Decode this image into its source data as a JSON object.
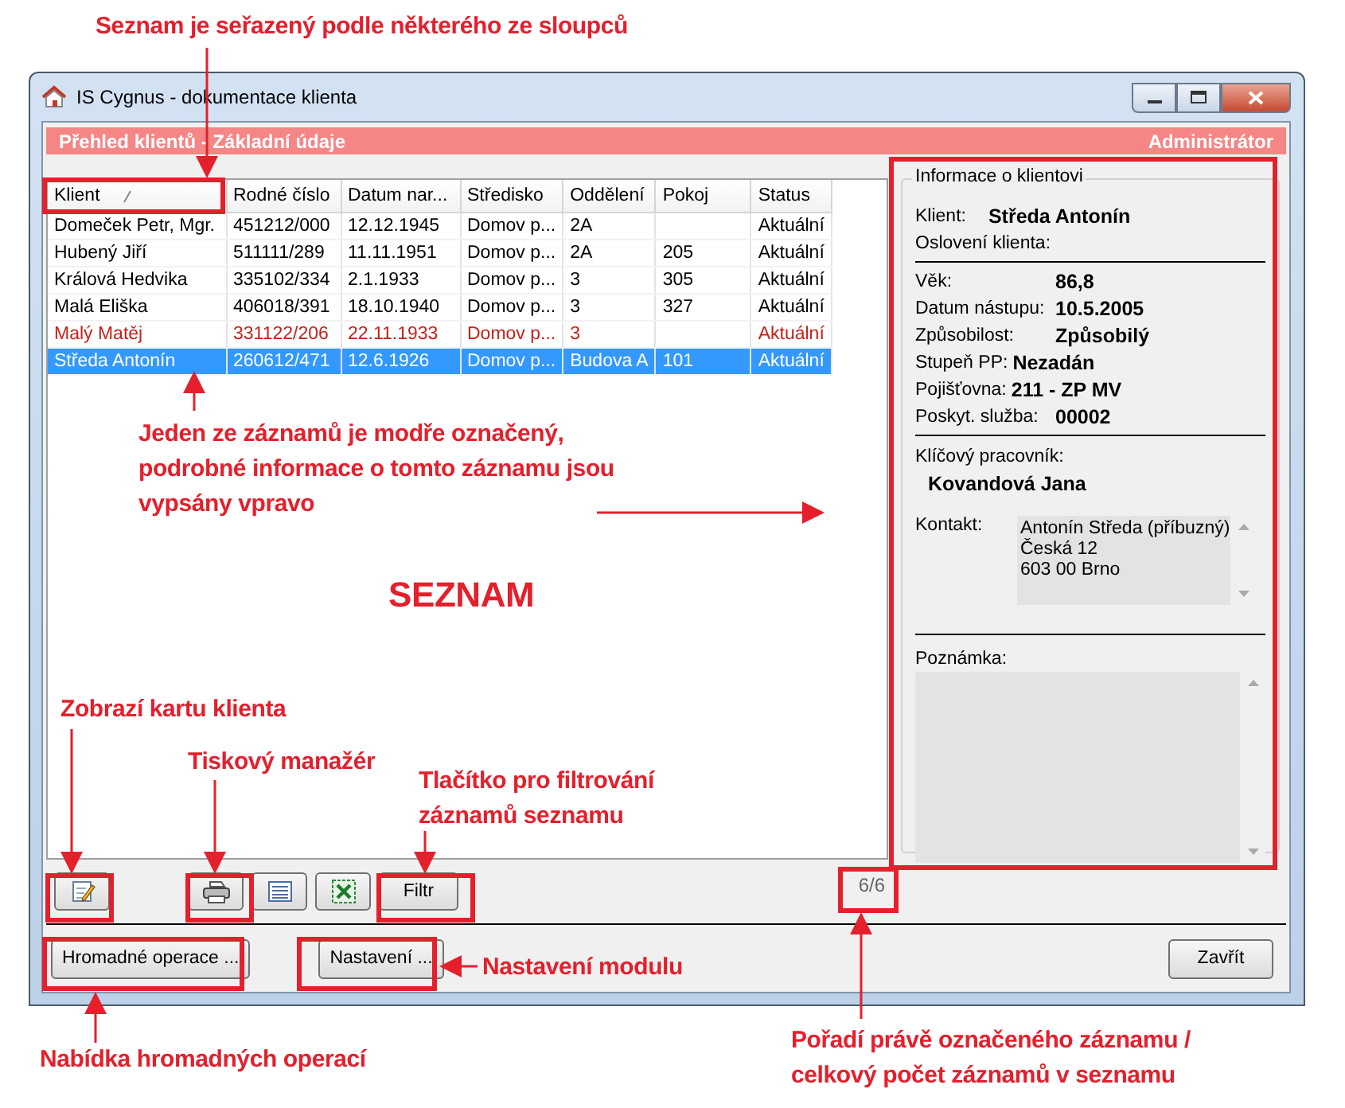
{
  "window": {
    "title": "IS Cygnus - dokumentace klienta"
  },
  "header": {
    "title": "Přehled klientů - Základní údaje",
    "user": "Administrátor"
  },
  "table": {
    "columns": [
      {
        "label": "Klient",
        "sorted": true
      },
      {
        "label": "Rodné číslo",
        "sorted": false
      },
      {
        "label": "Datum nar...",
        "sorted": false
      },
      {
        "label": "Středisko",
        "sorted": false
      },
      {
        "label": "Oddělení",
        "sorted": false
      },
      {
        "label": "Pokoj",
        "sorted": false
      },
      {
        "label": "Status",
        "sorted": false
      }
    ],
    "rows": [
      {
        "cells": [
          "Domeček Petr, Mgr.",
          "451212/000",
          "12.12.1945",
          "Domov p...",
          "2A",
          "",
          "Aktuální"
        ],
        "selected": false,
        "flagged": false
      },
      {
        "cells": [
          "Hubený Jiří",
          "511111/289",
          "11.11.1951",
          "Domov p...",
          "2A",
          "205",
          "Aktuální"
        ],
        "selected": false,
        "flagged": false
      },
      {
        "cells": [
          "Králová Hedvika",
          "335102/334",
          "2.1.1933",
          "Domov p...",
          "3",
          "305",
          "Aktuální"
        ],
        "selected": false,
        "flagged": false
      },
      {
        "cells": [
          "Malá Eliška",
          "406018/391",
          "18.10.1940",
          "Domov p...",
          "3",
          "327",
          "Aktuální"
        ],
        "selected": false,
        "flagged": false
      },
      {
        "cells": [
          "Malý Matěj",
          "331122/206",
          "22.11.1933",
          "Domov p...",
          "3",
          "",
          "Aktuální"
        ],
        "selected": false,
        "flagged": true
      },
      {
        "cells": [
          "Středa Antonín",
          "260612/471",
          "12.6.1926",
          "Domov p...",
          "Budova A",
          "101",
          "Aktuální"
        ],
        "selected": true,
        "flagged": false
      }
    ]
  },
  "info_panel": {
    "title": "Informace o klientovi",
    "client": {
      "label": "Klient:",
      "value": "Středa Antonín"
    },
    "salutation": {
      "label": "Oslovení klienta:"
    },
    "details": [
      {
        "kind": "aligned",
        "label": "Věk:",
        "value": "86,8"
      },
      {
        "kind": "aligned",
        "label": "Datum nástupu:",
        "value": "10.5.2005"
      },
      {
        "kind": "aligned",
        "label": "Způsobilost:",
        "value": "Způsobilý"
      },
      {
        "kind": "inline",
        "label": "Stupeň PP:",
        "value": "Nezadán"
      },
      {
        "kind": "inline",
        "label": "Pojišťovna:",
        "value": "211 - ZP MV"
      },
      {
        "kind": "aligned",
        "label": "Poskyt. služba:",
        "value": "00002"
      }
    ],
    "key_worker": {
      "label": "Klíčový pracovník:",
      "value": "Kovandová Jana"
    },
    "contact": {
      "label": "Kontakt:",
      "lines": [
        "Antonín Středa (příbuzný)",
        "Česká 12",
        "603 00 Brno"
      ]
    },
    "note": {
      "label": "Poznámka:"
    }
  },
  "toolbar": [
    {
      "buttons": [
        {
          "kind": "edit"
        }
      ]
    },
    {
      "buttons": [
        {
          "kind": "print"
        },
        {
          "kind": "list"
        },
        {
          "kind": "spreadsheet"
        },
        {
          "kind": "text",
          "label": "Filtr"
        }
      ]
    }
  ],
  "record_counter": "6/6",
  "footer_buttons": [
    {
      "label": "Hromadné operace ..."
    },
    {
      "label": "Nastavení ..."
    }
  ],
  "close_button": "Zavřít",
  "annotations": [
    {
      "text": "Seznam je seřazený podle některého ze sloupců"
    },
    {
      "text": "Jeden ze záznamů je modře označený, podrobné informace o tomto záznamu jsou vypsány vpravo"
    },
    {
      "text": "SEZNAM"
    },
    {
      "text": "Zobrazí kartu klienta"
    },
    {
      "text": "Tiskový manažér"
    },
    {
      "text": "Tlačítko pro filtrování záznamů seznamu"
    },
    {
      "text": "Nastavení modulu"
    },
    {
      "text": "Nabídka hromadných operací"
    },
    {
      "text": "Pořadí právě označeného záznamu / celkový počet záznamů v seznamu"
    }
  ]
}
